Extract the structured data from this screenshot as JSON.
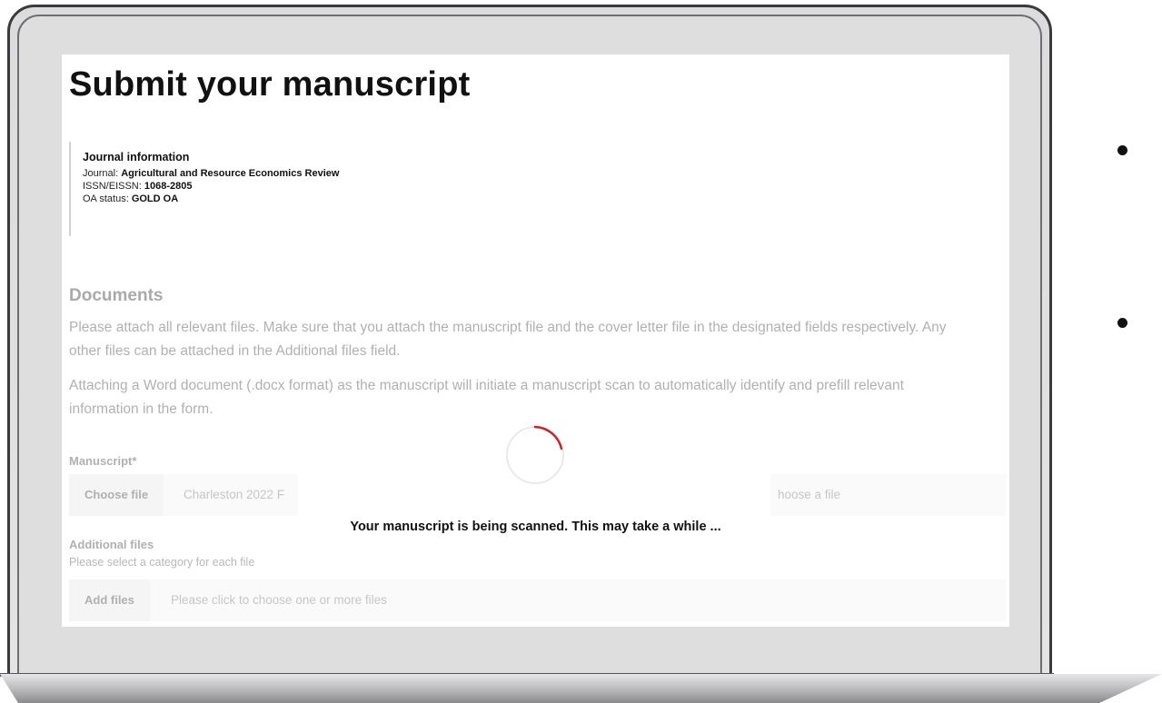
{
  "page": {
    "title": "Submit your manuscript"
  },
  "journal_info": {
    "heading": "Journal information",
    "journal_label": "Journal:",
    "journal_value": "Agricultural and Resource Economics Review",
    "issn_label": "ISSN/EISSN:",
    "issn_value": "1068-2805",
    "oa_label": "OA status:",
    "oa_value": "GOLD OA"
  },
  "documents": {
    "heading": "Documents",
    "paragraph_1": "Please attach all relevant files. Make sure that you attach the manuscript file and the cover letter file in the designated fields respectively. Any other files can be attached in the Additional files field.",
    "paragraph_2": "Attaching a Word document (.docx format) as the manuscript will initiate a manuscript scan to automatically identify and prefill relevant information in the form."
  },
  "manuscript_field": {
    "label": "Manuscript*",
    "button_label": "Choose file",
    "file_name": "Charleston 2022 F",
    "placeholder_tail": "hoose a file"
  },
  "additional_files": {
    "label": "Additional files",
    "sublabel": "Please select a category for each file",
    "button_label": "Add files",
    "placeholder": "Please click to choose one or more files"
  },
  "scan_overlay": {
    "message": "Your manuscript is being scanned. This may take a while ..."
  },
  "colors": {
    "spinner_accent": "#c8242b",
    "spinner_track": "#e9e9ea"
  }
}
